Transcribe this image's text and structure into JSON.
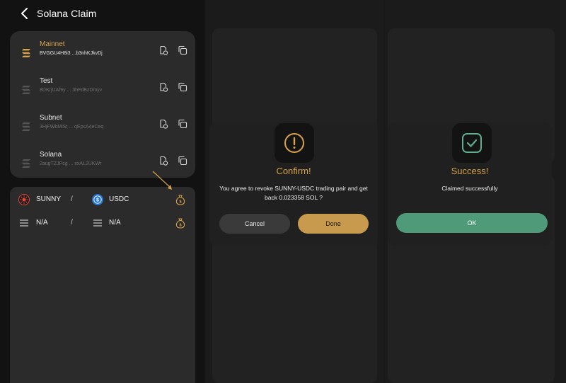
{
  "colors": {
    "accent_gold": "#d7a24a",
    "dim_icon": "#555555",
    "ok_green": "#4f9a78",
    "success_icon": "#5fae8c"
  },
  "header": {
    "title": "Solana Claim",
    "back_icon": "chevron-left-icon"
  },
  "networks": [
    {
      "name": "Mainnet",
      "address": "BVGGU4H8i3 ...b3nhKJkvDj",
      "active": true
    },
    {
      "name": "Test",
      "address": "8DKrjUAf9y ... 3hFdBzDmyv",
      "active": false
    },
    {
      "name": "Subnet",
      "address": "3HjFWbMiSt ... qEpsA4eCeq",
      "active": false
    },
    {
      "name": "Solana",
      "address": "2augTZJPcg ... xxAL2UKWr",
      "active": false
    }
  ],
  "pairs": [
    {
      "base": "SUNNY",
      "base_icon": "sunny-token-icon",
      "sep": "/",
      "quote": "USDC",
      "quote_icon": "usdc-token-icon"
    },
    {
      "base": "N/A",
      "base_icon": "solana-token-icon",
      "sep": "/",
      "quote": "N/A",
      "quote_icon": "solana-token-icon"
    }
  ],
  "confirm_dialog": {
    "title": "Confirm!",
    "message": "You agree to revoke SUNNY-USDC trading pair and get back 0.023358 SOL ?",
    "cancel_label": "Cancel",
    "done_label": "Done",
    "icon": "exclamation-icon"
  },
  "success_dialog": {
    "title": "Success!",
    "message": "Claimed successfully",
    "ok_label": "OK",
    "icon": "checkmark-icon"
  }
}
